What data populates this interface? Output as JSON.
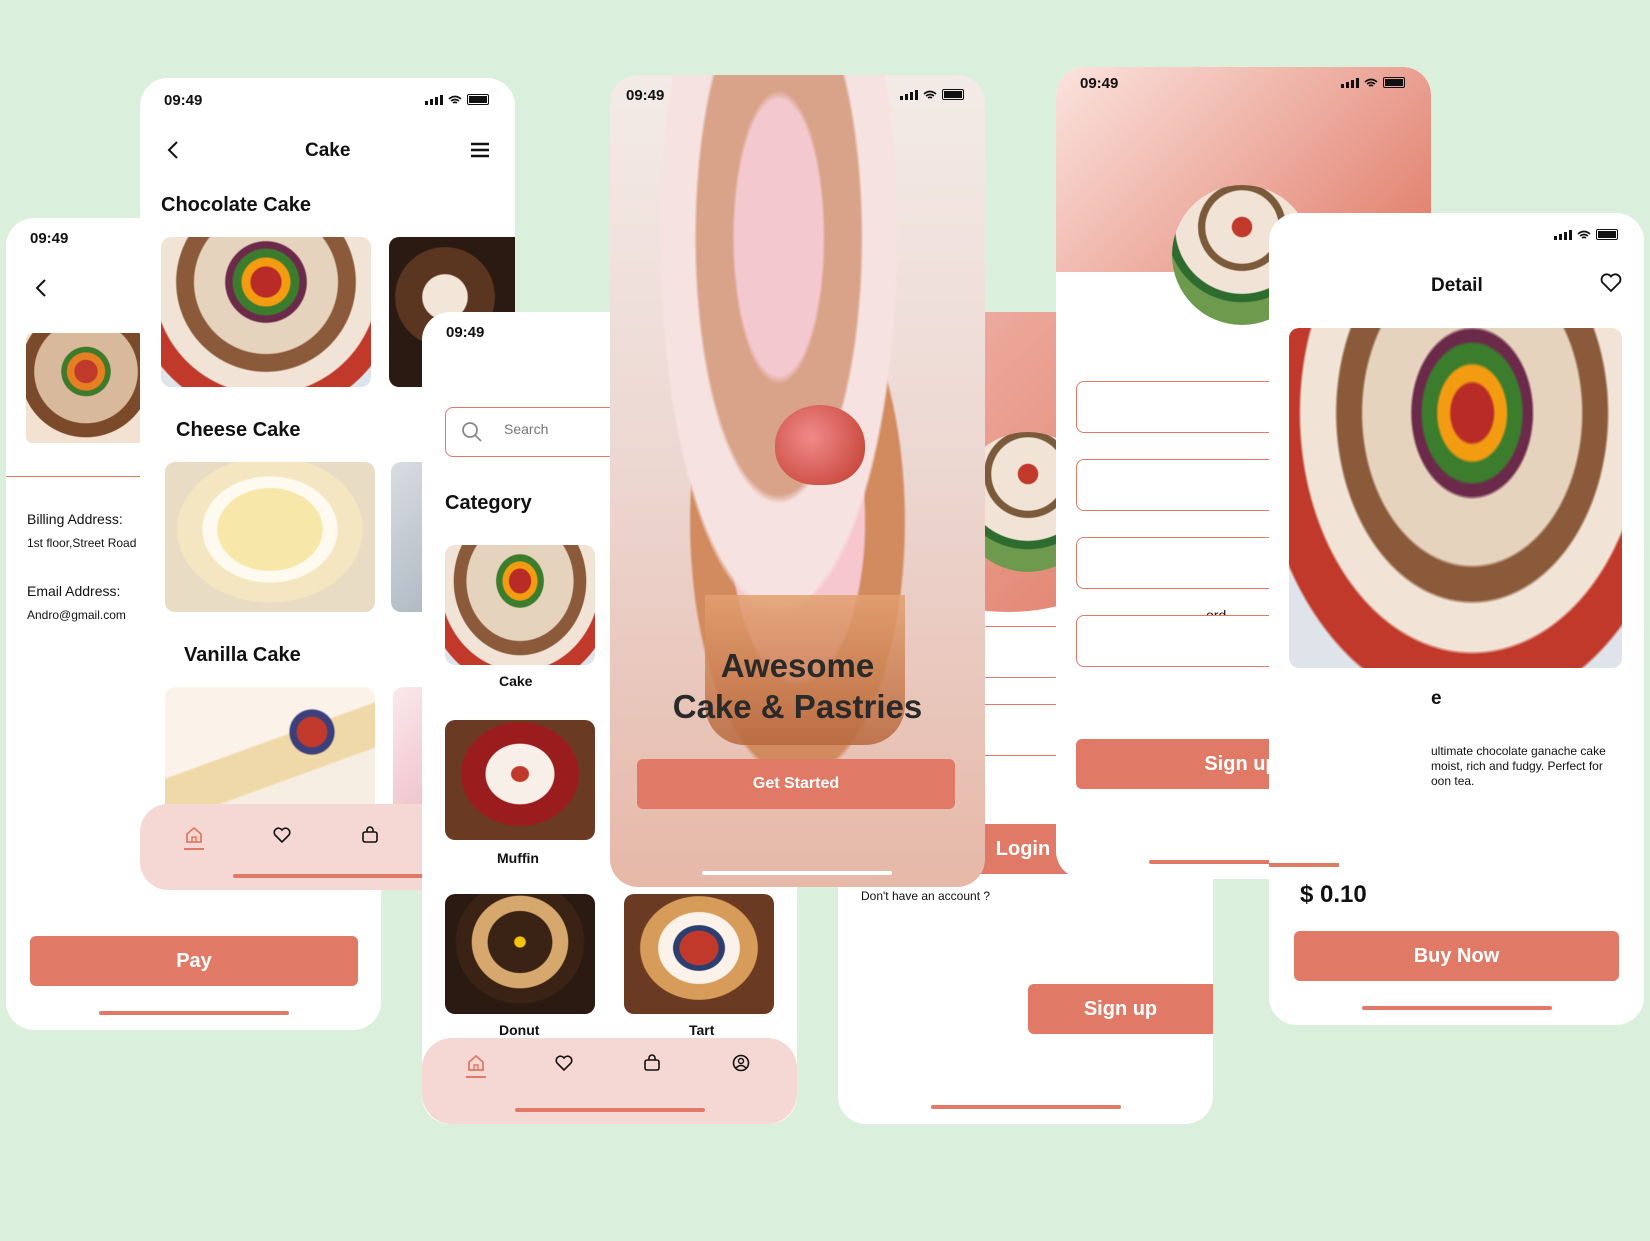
{
  "time": "09:49",
  "payment_screen": {
    "billing_label": "Billing Address:",
    "billing_value": "1st floor,Street Road",
    "email_label": "Email Address:",
    "email_value": "Andro@gmail.com",
    "pay_button": "Pay"
  },
  "cake_list_screen": {
    "title": "Cake",
    "sections": [
      "Chocolate Cake",
      "Cheese Cake",
      "Vanilla Cake"
    ]
  },
  "category_screen": {
    "search_placeholder": "Search",
    "category_heading": "Category",
    "items": [
      "Cake",
      "Muffin",
      "Donut",
      "Tart"
    ]
  },
  "welcome_screen": {
    "headline_line1": "Awesome",
    "headline_line2": "Cake & Pastries",
    "get_started": "Get Started"
  },
  "login_screen": {
    "login_button": "Login",
    "no_account_text": "Don't have an account ?",
    "signup_button": "Sign up"
  },
  "signup_screen": {
    "password_label_fragment": "ord",
    "signup_button": "Sign up"
  },
  "detail_screen": {
    "title": "Detail",
    "name_fragment": "e",
    "description": "ultimate chocolate ganache cake moist, rich and fudgy. Perfect for oon tea.",
    "price": "$ 0.10",
    "buy_now": "Buy Now"
  },
  "colors": {
    "accent": "#e07a66",
    "nav_bg": "#f5d8d3",
    "background": "#dbf0dc"
  }
}
